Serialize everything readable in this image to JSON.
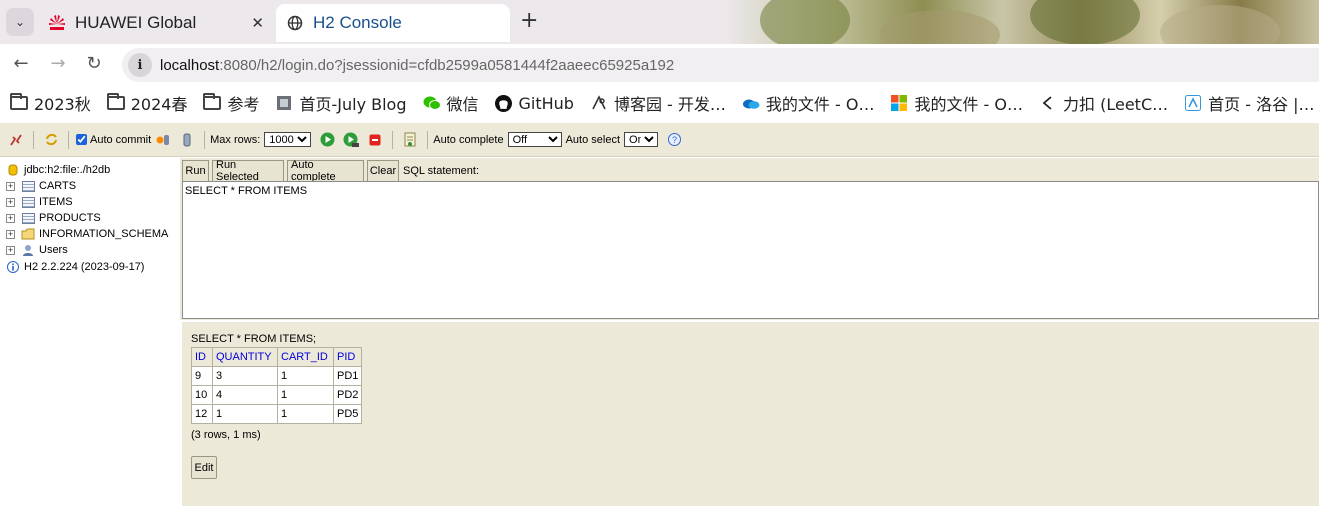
{
  "browser": {
    "tabs": [
      {
        "title": "HUAWEI Global",
        "icon": "huawei-logo-icon",
        "active": false
      },
      {
        "title": "H2 Console",
        "icon": "globe-icon",
        "active": true
      }
    ],
    "url": {
      "host": "localhost",
      "rest": ":8080/h2/login.do?jsessionid=cfdb2599a0581444f2aaeec65925a192"
    },
    "bookmarks": [
      {
        "label": "2023秋",
        "icon": "folder-icon"
      },
      {
        "label": "2024春",
        "icon": "folder-icon"
      },
      {
        "label": "参考",
        "icon": "folder-icon"
      },
      {
        "label": "首页-July Blog",
        "icon": "july-blog-icon"
      },
      {
        "label": "微信",
        "icon": "wechat-icon"
      },
      {
        "label": "GitHub",
        "icon": "github-icon"
      },
      {
        "label": "博客园 - 开发…",
        "icon": "cnblogs-icon"
      },
      {
        "label": "我的文件 - O…",
        "icon": "onedrive-icon"
      },
      {
        "label": "我的文件 - O…",
        "icon": "microsoft-icon"
      },
      {
        "label": "力扣 (LeetC…",
        "icon": "leetcode-icon"
      },
      {
        "label": "首页 - 洛谷 |…",
        "icon": "luogu-icon"
      }
    ]
  },
  "toolbar": {
    "auto_commit_label": "Auto commit",
    "auto_commit_checked": true,
    "max_rows_label": "Max rows:",
    "max_rows_value": "1000",
    "auto_complete_label": "Auto complete",
    "auto_complete_value": "Off",
    "auto_select_label": "Auto select",
    "auto_select_value": "On",
    "help_label": "?"
  },
  "tree": {
    "connection": "jdbc:h2:file:./h2db",
    "items": [
      {
        "label": "CARTS",
        "type": "table"
      },
      {
        "label": "ITEMS",
        "type": "table"
      },
      {
        "label": "PRODUCTS",
        "type": "table"
      },
      {
        "label": "INFORMATION_SCHEMA",
        "type": "folder"
      },
      {
        "label": "Users",
        "type": "users"
      }
    ],
    "version": "H2 2.2.224 (2023-09-17)"
  },
  "query": {
    "run": "Run",
    "run_selected": "Run Selected",
    "auto_complete": "Auto complete",
    "clear": "Clear",
    "sql_label": "SQL statement:",
    "sql_text": "SELECT * FROM ITEMS"
  },
  "result": {
    "statement": "SELECT * FROM ITEMS;",
    "columns": [
      "ID",
      "QUANTITY",
      "CART_ID",
      "PID"
    ],
    "rows": [
      [
        "9",
        "3",
        "1",
        "PD1"
      ],
      [
        "10",
        "4",
        "1",
        "PD2"
      ],
      [
        "12",
        "1",
        "1",
        "PD5"
      ]
    ],
    "summary": "(3 rows, 1 ms)",
    "edit": "Edit"
  },
  "colors": {
    "h2_panel": "#ece9d8",
    "header_link": "#0000e0",
    "tab_active": "#ffffff"
  }
}
